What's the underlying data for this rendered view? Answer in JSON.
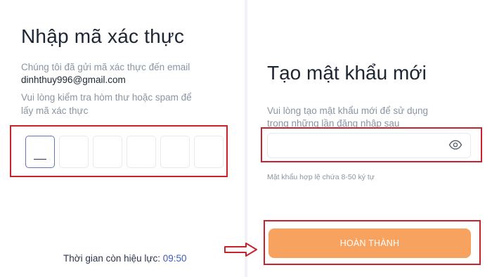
{
  "left": {
    "title": "Nhập mã xác thực",
    "description_line1": "Chúng tôi đã gửi mã xác thực đến email",
    "email": "dinhthuy996@gmail.com",
    "description_line2": "Vui lòng kiểm tra hòm thư hoặc spam để",
    "description_line3": "lấy mã xác thực",
    "otp_boxes": [
      "",
      "",
      "",
      "",
      "",
      ""
    ],
    "timer_label": "Thời gian còn hiệu lực:",
    "timer_value": "09:50"
  },
  "right": {
    "title": "Tạo mật khẩu mới",
    "description_line1": "Vui lòng tạo mật khẩu mới để sử dụng",
    "description_line2": "trong những lần đăng nhập sau",
    "password_value": "",
    "password_hint": "Mật khẩu hợp lệ chứa 8-50 ký tự",
    "submit_label": "HOÀN THÀNH"
  },
  "colors": {
    "accent_button": "#f7a25e",
    "highlight_frame": "#c8232c",
    "timer": "#3f5bb8",
    "otp_active_border": "#6573b8"
  },
  "icons": {
    "password_toggle": "eye-icon",
    "pointer": "right-arrow-icon"
  }
}
